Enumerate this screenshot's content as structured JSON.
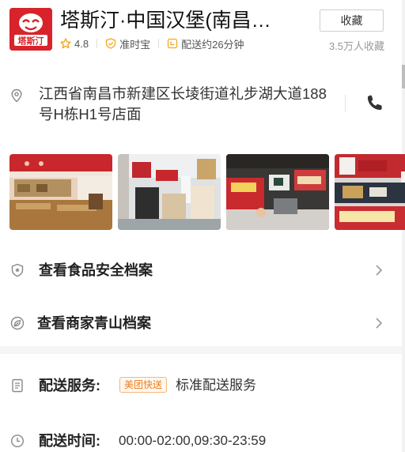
{
  "shop": {
    "name": "塔斯汀·中国汉堡(南昌…",
    "logo_text": "塔斯汀",
    "rating": "4.8",
    "badge_label": "准时宝",
    "delivery_eta": "配送约26分钟",
    "favorite_label": "收藏",
    "favorite_count": "3.5万人收藏"
  },
  "address": {
    "text": "江西省南昌市新建区长堎街道礼步湖大道188号H栋H1号店面"
  },
  "photos": [
    {
      "name": "photo-1"
    },
    {
      "name": "photo-2"
    },
    {
      "name": "photo-3"
    },
    {
      "name": "photo-4"
    }
  ],
  "links": {
    "food_safety": "查看食品安全档案",
    "green_mountain": "查看商家青山档案"
  },
  "delivery": {
    "service_label": "配送服务:",
    "service_tag": "美团快送",
    "service_value": "标准配送服务",
    "time_label": "配送时间:",
    "time_value": "00:00-02:00,09:30-23:59"
  },
  "colors": {
    "brand_red": "#d8232a",
    "star": "#f5a623",
    "badge": "#f5a623",
    "tag_orange": "#ef7c1c"
  },
  "icons": {
    "location": "location-pin-icon",
    "phone": "phone-icon",
    "food_safety": "shield-star-icon",
    "green_mountain": "leaf-icon",
    "service": "document-icon",
    "time": "clock-icon",
    "chevron": "chevron-right-icon"
  }
}
